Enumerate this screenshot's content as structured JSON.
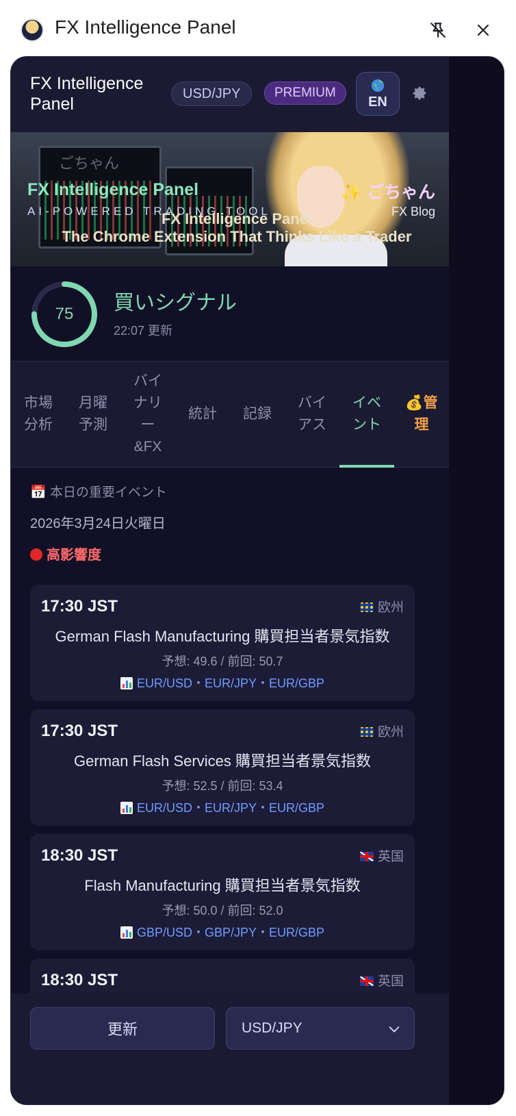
{
  "browser": {
    "panel_title": "FX Intelligence Panel"
  },
  "header": {
    "app_title": "FX Intelligence Panel",
    "pair_badge": "USD/JPY",
    "plan_badge": "PREMIUM",
    "language": "EN"
  },
  "banner": {
    "watermark": "ごちゃん",
    "title": "FX Intelligence Panel",
    "subtitle": "AI-POWERED TRADING TOOL",
    "title_center": "FX Intelligence Panel",
    "tagline": "The Chrome Extension That Thinks Like a Trader",
    "brand": "ごちゃん",
    "brand_sub": "FX Blog"
  },
  "signal": {
    "score": "75",
    "score_value": 75,
    "label": "買いシグナル",
    "updated": "22:07 更新",
    "color": "#7fd8b2"
  },
  "tabs": [
    {
      "label": "市場分析",
      "lines": [
        "市場",
        "分析"
      ]
    },
    {
      "label": "月曜予測",
      "lines": [
        "月曜",
        "予測"
      ]
    },
    {
      "label": "バイナリー&FX",
      "lines": [
        "バイ",
        "ナリ",
        "ー",
        "&FX"
      ]
    },
    {
      "label": "統計",
      "lines": [
        "統計"
      ]
    },
    {
      "label": "記録",
      "lines": [
        "記録"
      ]
    },
    {
      "label": "バイアス",
      "lines": [
        "バイ",
        "アス"
      ]
    },
    {
      "label": "イベント",
      "lines": [
        "イベ",
        "ント"
      ],
      "active": true
    },
    {
      "label": "💰管理",
      "lines": [
        "💰管",
        "理"
      ]
    }
  ],
  "events": {
    "heading": "本日の重要イベント",
    "date": "2026年3月24日火曜日",
    "impact_label": "高影響度",
    "items": [
      {
        "time": "17:30 JST",
        "region": "欧州",
        "flag": "eu",
        "name": "German Flash Manufacturing 購買担当者景気指数",
        "forecast": "予想: 49.6 / 前回: 50.7",
        "pairs": "EUR/USD・EUR/JPY・EUR/GBP"
      },
      {
        "time": "17:30 JST",
        "region": "欧州",
        "flag": "eu",
        "name": "German Flash Services 購買担当者景気指数",
        "forecast": "予想: 52.5 / 前回: 53.4",
        "pairs": "EUR/USD・EUR/JPY・EUR/GBP"
      },
      {
        "time": "18:30 JST",
        "region": "英国",
        "flag": "uk",
        "name": "Flash Manufacturing 購買担当者景気指数",
        "forecast": "予想: 50.0 / 前回: 52.0",
        "pairs": "GBP/USD・GBP/JPY・EUR/GBP"
      },
      {
        "time": "18:30 JST",
        "region": "英国",
        "flag": "uk",
        "name": "",
        "forecast": "",
        "pairs": ""
      }
    ]
  },
  "footer": {
    "refresh_label": "更新",
    "pair_select_value": "USD/JPY"
  },
  "colors": {
    "accent": "#7fd8b2",
    "premium": "#4a2c7e",
    "impact": "#ff6b6b",
    "pairs": "#6f9cff",
    "manage": "#f2a04a"
  }
}
